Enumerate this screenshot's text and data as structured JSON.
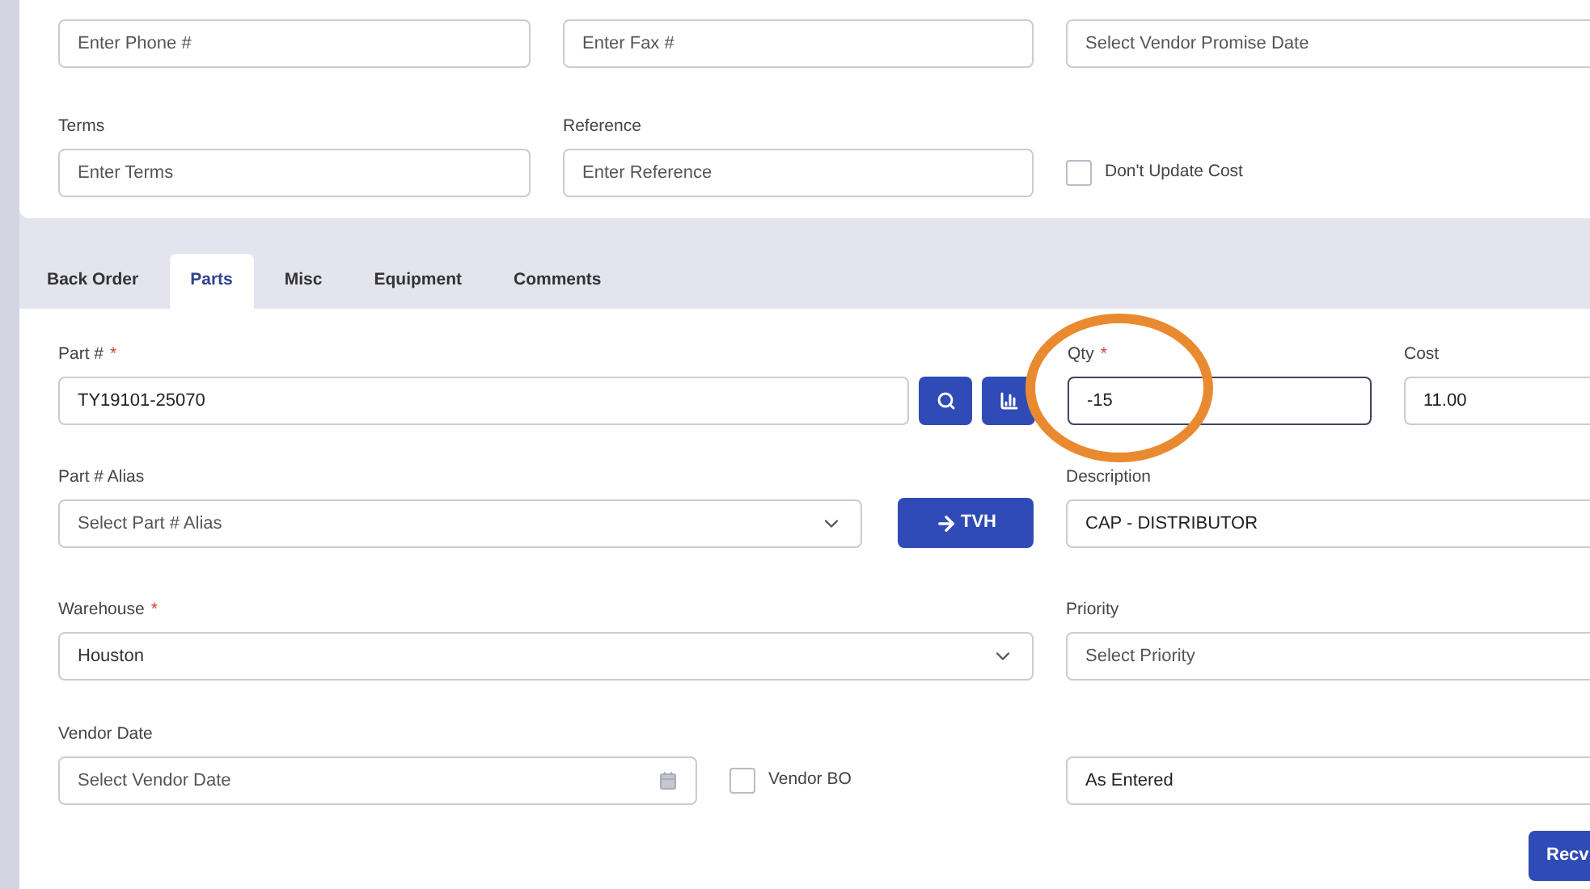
{
  "top_form": {
    "row_1": [
      {
        "kind": "input",
        "placeholder": "Enter Phone #"
      },
      {
        "kind": "input",
        "placeholder": "Enter Fax #"
      },
      {
        "kind": "input",
        "placeholder": "Select Vendor Promise Date"
      }
    ],
    "row_2": [
      {
        "kind": "input",
        "label": "Terms",
        "placeholder": "Enter Terms"
      },
      {
        "kind": "input",
        "label": "Reference",
        "placeholder": "Enter Reference"
      },
      {
        "kind": "checkbox",
        "label": "Don't Update Cost",
        "checked": false
      }
    ]
  },
  "tabs": [
    {
      "label": "Back Order",
      "selected": false
    },
    {
      "label": "Parts",
      "selected": true
    },
    {
      "label": "Misc",
      "selected": false
    },
    {
      "label": "Equipment",
      "selected": false
    },
    {
      "label": "Comments",
      "selected": false
    }
  ],
  "parts_form": {
    "part_number": {
      "label": "Part #",
      "required_mark": "*",
      "value": "TY19101-25070"
    },
    "qty": {
      "label": "Qty",
      "required_mark": "*",
      "value": "-15",
      "focused": true
    },
    "cost": {
      "label": "Cost",
      "value": "11.00"
    },
    "part_alias": {
      "label": "Part # Alias",
      "placeholder": "Select Part # Alias"
    },
    "tvh_button": {
      "label": "TVH"
    },
    "description": {
      "label": "Description",
      "value": "CAP - DISTRIBUTOR"
    },
    "warehouse": {
      "label": "Warehouse",
      "required_mark": "*",
      "value": "Houston"
    },
    "priority": {
      "label": "Priority",
      "placeholder": "Select Priority"
    },
    "vendor_date": {
      "label": "Vendor Date",
      "placeholder": "Select Vendor Date"
    },
    "vendor_bo": {
      "label": "Vendor BO",
      "checked": false
    },
    "pricing": {
      "value": "As Entered"
    },
    "recv_button": {
      "label": "Recv"
    }
  }
}
